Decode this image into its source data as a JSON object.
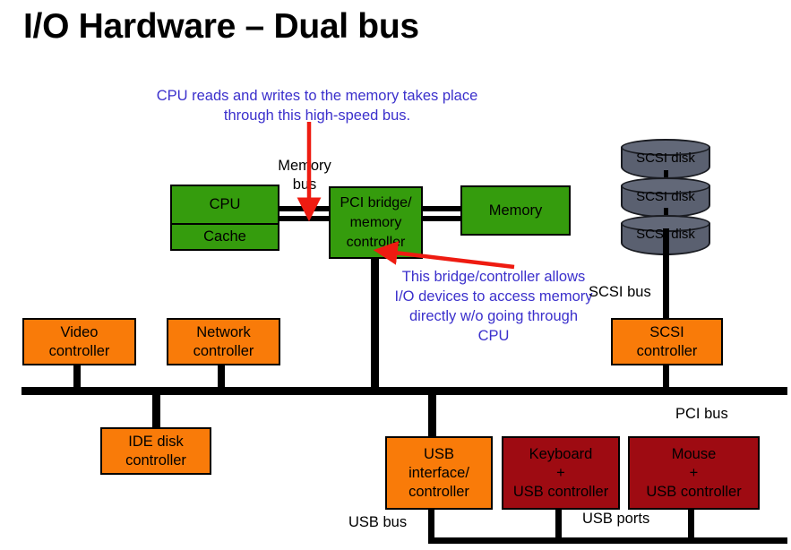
{
  "page": {
    "title": "I/O Hardware – Dual bus",
    "background_color": "#ffffff"
  },
  "colors": {
    "green_block": "#359c0d",
    "orange_block": "#f97b09",
    "dark_red_block": "#9e0b12",
    "disk_gray": "#5a6070",
    "annotation_blue": "#3b30cc",
    "arrow_red": "#ee1b11",
    "bus_black": "#000000"
  },
  "annotations": [
    {
      "id": "memory-bus-note",
      "text": "CPU reads and writes to the memory takes place through this high-speed bus.",
      "color": "#3b30cc"
    },
    {
      "id": "bridge-note",
      "text": "This bridge/controller allows I/O devices to access memory directly w/o going through CPU",
      "color": "#3b30cc"
    }
  ],
  "blocks": {
    "cpu": "CPU",
    "cache": "Cache",
    "pci_bridge": "PCI bridge/\nmemory\ncontroller",
    "memory": "Memory",
    "video_controller": "Video\ncontroller",
    "network_controller": "Network\ncontroller",
    "scsi_controller": "SCSI\ncontroller",
    "ide_controller": "IDE disk\ncontroller",
    "usb_interface": "USB\ninterface/\ncontroller",
    "keyboard": "Keyboard\n+\nUSB controller",
    "mouse": "Mouse\n+\nUSB controller"
  },
  "disks": [
    {
      "label": "SCSI disk"
    },
    {
      "label": "SCSI disk"
    },
    {
      "label": "SCSI disk"
    }
  ],
  "bus_labels": {
    "memory_bus": "Memory\nbus",
    "scsi_bus": "SCSI bus",
    "pci_bus": "PCI bus",
    "usb_bus": "USB bus",
    "usb_ports": "USB ports"
  }
}
